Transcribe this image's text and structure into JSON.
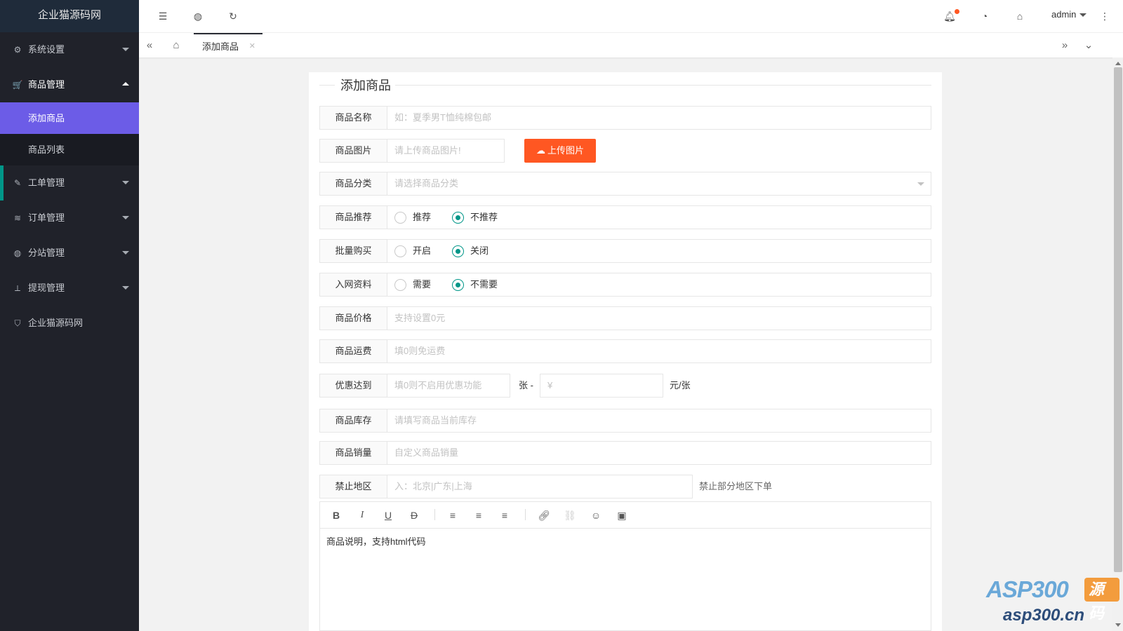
{
  "brand": {
    "title": "企业猫源码网"
  },
  "colors": {
    "sidebar": "#20222a",
    "active_menu": "#6c5ce7",
    "accent_green": "#009688",
    "upload_button": "#ff5722"
  },
  "sidebar": {
    "items": [
      {
        "label": "系统设置",
        "icon": "gear-icon"
      },
      {
        "label": "商品管理",
        "icon": "cart-icon",
        "open": true,
        "children": [
          {
            "label": "添加商品",
            "active": true
          },
          {
            "label": "商品列表"
          }
        ]
      },
      {
        "label": "工单管理",
        "icon": "ticket-icon"
      },
      {
        "label": "订单管理",
        "icon": "layers-icon"
      },
      {
        "label": "分站管理",
        "icon": "globe-icon"
      },
      {
        "label": "提现管理",
        "icon": "withdraw-icon"
      },
      {
        "label": "企业猫源码网",
        "icon": "shield-icon"
      }
    ]
  },
  "header": {
    "user": "admin"
  },
  "tabs": {
    "active": "添加商品"
  },
  "form": {
    "title": "添加商品",
    "name": {
      "label": "商品名称",
      "placeholder": "如：夏季男T恤纯棉包邮"
    },
    "image": {
      "label": "商品图片",
      "placeholder": "请上传商品图片!",
      "button": "上传图片"
    },
    "category": {
      "label": "商品分类",
      "placeholder": "请选择商品分类"
    },
    "recommend": {
      "label": "商品推荐",
      "options": [
        "推荐",
        "不推荐"
      ],
      "selected": "不推荐"
    },
    "bulk": {
      "label": "批量购买",
      "options": [
        "开启",
        "关闭"
      ],
      "selected": "关闭"
    },
    "netinfo": {
      "label": "入网资料",
      "options": [
        "需要",
        "不需要"
      ],
      "selected": "不需要"
    },
    "price": {
      "label": "商品价格",
      "placeholder": "支持设置0元"
    },
    "shipping": {
      "label": "商品运费",
      "placeholder": "填0则免运费"
    },
    "discount": {
      "label": "优惠达到",
      "placeholder": "填0则不启用优惠功能",
      "unit1": "张 -",
      "placeholder2": "¥",
      "unit2": "元/张"
    },
    "stock": {
      "label": "商品库存",
      "placeholder": "请填写商品当前库存"
    },
    "sales": {
      "label": "商品销量",
      "placeholder": "自定义商品销量"
    },
    "region": {
      "label": "禁止地区",
      "placeholder": "入：北京|广东|上海",
      "note": "禁止部分地区下单"
    },
    "editor": {
      "content": "商品说明，支持html代码"
    }
  },
  "watermark": {
    "line1": "ASP300",
    "badge": "源码",
    "line2": "asp300.cn"
  }
}
